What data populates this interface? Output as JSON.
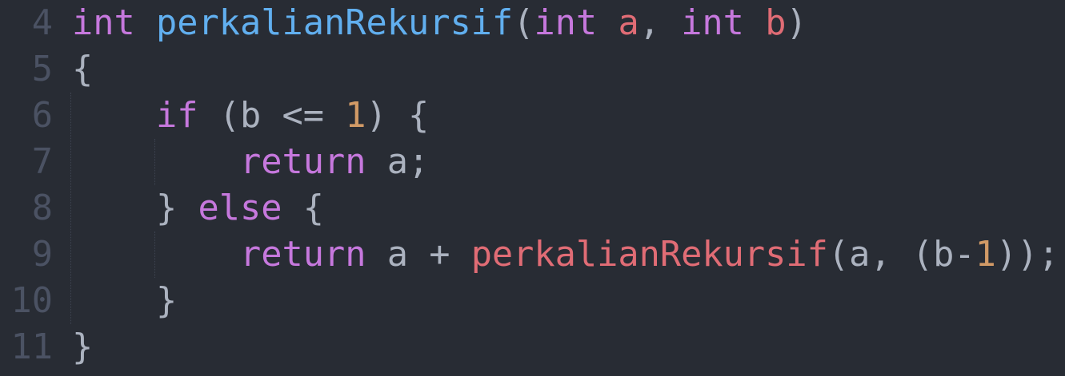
{
  "editor": {
    "lines": [
      {
        "number": "4",
        "indent": 0,
        "tokens": [
          [
            "int",
            "kw"
          ],
          [
            " ",
            "txt"
          ],
          [
            "perkalianRekursif",
            "fn"
          ],
          [
            "(",
            "txt"
          ],
          [
            "int",
            "kw"
          ],
          [
            " ",
            "txt"
          ],
          [
            "a",
            "param"
          ],
          [
            ", ",
            "txt"
          ],
          [
            "int",
            "kw"
          ],
          [
            " ",
            "txt"
          ],
          [
            "b",
            "param"
          ],
          [
            ")",
            "txt"
          ]
        ]
      },
      {
        "number": "5",
        "indent": 0,
        "tokens": [
          [
            "{",
            "txt"
          ]
        ]
      },
      {
        "number": "6",
        "indent": 4,
        "tokens": [
          [
            "if",
            "kw"
          ],
          [
            " (b <= ",
            "txt"
          ],
          [
            "1",
            "num"
          ],
          [
            ") {",
            "txt"
          ]
        ]
      },
      {
        "number": "7",
        "indent": 8,
        "tokens": [
          [
            "return",
            "kw"
          ],
          [
            " a;",
            "txt"
          ]
        ]
      },
      {
        "number": "8",
        "indent": 4,
        "tokens": [
          [
            "} ",
            "txt"
          ],
          [
            "else",
            "kw"
          ],
          [
            " {",
            "txt"
          ]
        ]
      },
      {
        "number": "9",
        "indent": 8,
        "tokens": [
          [
            "return",
            "kw"
          ],
          [
            " a + ",
            "txt"
          ],
          [
            "perkalianRekursif",
            "call"
          ],
          [
            "(a, (b-",
            "txt"
          ],
          [
            "1",
            "num"
          ],
          [
            "));",
            "txt"
          ]
        ]
      },
      {
        "number": "10",
        "indent": 4,
        "tokens": [
          [
            "}",
            "txt"
          ]
        ]
      },
      {
        "number": "11",
        "indent": 0,
        "tokens": [
          [
            "}",
            "txt"
          ]
        ]
      }
    ]
  }
}
